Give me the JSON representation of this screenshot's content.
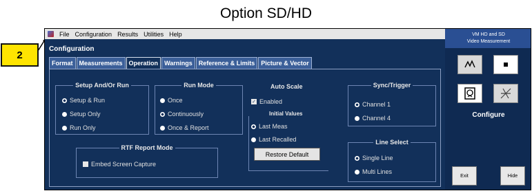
{
  "caption": "Option SD/HD",
  "callout": "2",
  "menu": [
    "File",
    "Configuration",
    "Results",
    "Utilities",
    "Help"
  ],
  "title": "Configuration",
  "tabs": [
    "Format",
    "Measurements",
    "Operation",
    "Warnings",
    "Reference & Limits",
    "Picture & Vector"
  ],
  "active_tab": "Operation",
  "setup": {
    "title": "Setup And/Or Run",
    "options": [
      "Setup & Run",
      "Setup Only",
      "Run Only"
    ],
    "selected": "Setup & Run"
  },
  "run_mode": {
    "title": "Run Mode",
    "options": [
      "Once",
      "Continuously",
      "Once & Report"
    ],
    "selected": "Continuously"
  },
  "auto_scale": {
    "title": "Auto Scale",
    "enabled_label": "Enabled",
    "enabled": true
  },
  "initial_values": {
    "title": "Initial Values",
    "options": [
      "Last Meas",
      "Last Recalled"
    ],
    "selected": "Last Meas",
    "restore_label": "Restore Default"
  },
  "sync_trigger": {
    "title": "Sync/Trigger",
    "options": [
      "Channel 1",
      "Channel 4"
    ],
    "selected": "Channel 1"
  },
  "line_select": {
    "title": "Line Select",
    "options": [
      "Single Line",
      "Multi Lines"
    ],
    "selected": "Single Line"
  },
  "rtf": {
    "title": "RTF Report Mode",
    "checkbox_label": "Embed Screen Capture",
    "checked": false
  },
  "side": {
    "header_line1": "VM HD and SD",
    "header_line2": "Video Measurement",
    "configure": "Configure",
    "exit": "Exit",
    "hide": "Hide"
  }
}
